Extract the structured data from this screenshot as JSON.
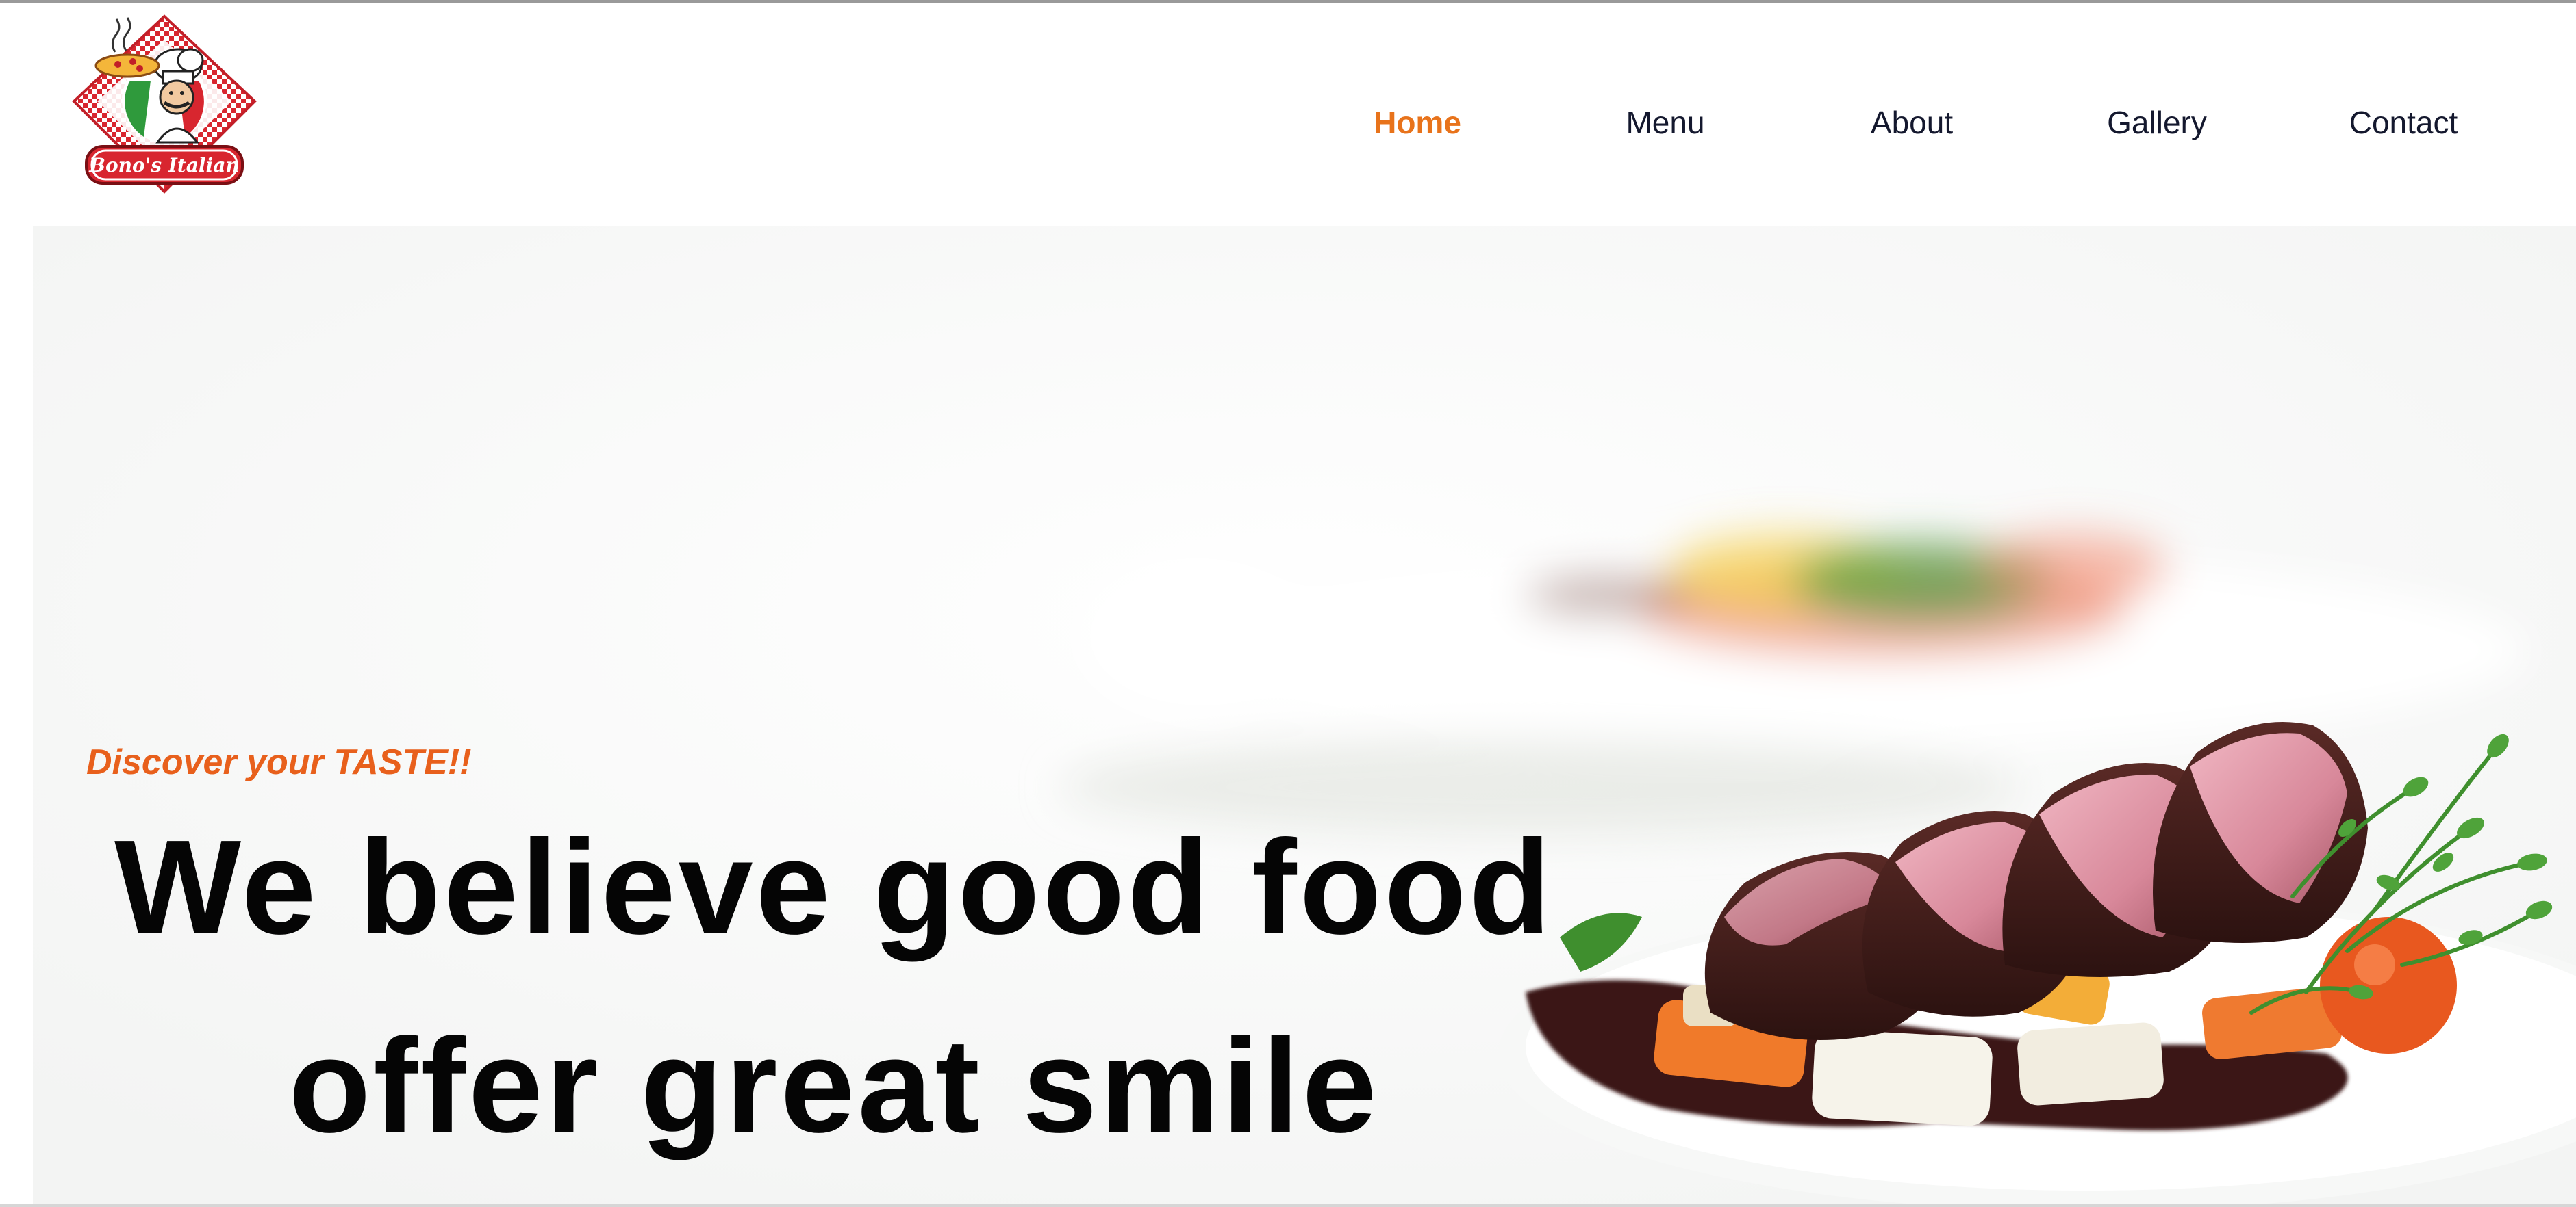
{
  "brand": {
    "logo_text": "Bono's Italian"
  },
  "nav": {
    "items": [
      {
        "label": "Home",
        "active": true
      },
      {
        "label": "Menu",
        "active": false
      },
      {
        "label": "About",
        "active": false
      },
      {
        "label": "Gallery",
        "active": false
      },
      {
        "label": "Contact",
        "active": false
      }
    ]
  },
  "hero": {
    "tagline": "Discover your TASTE!!",
    "headline_line1": "We believe good food",
    "headline_line2": "offer great smile"
  },
  "colors": {
    "accent": "#e8731b",
    "tagline": "#e8601c",
    "nav_text": "#14182e",
    "headline": "#050505"
  },
  "icons": {
    "logo": "chef-pizza-logo-icon",
    "hero_image": "plated-steak-dish-image"
  }
}
